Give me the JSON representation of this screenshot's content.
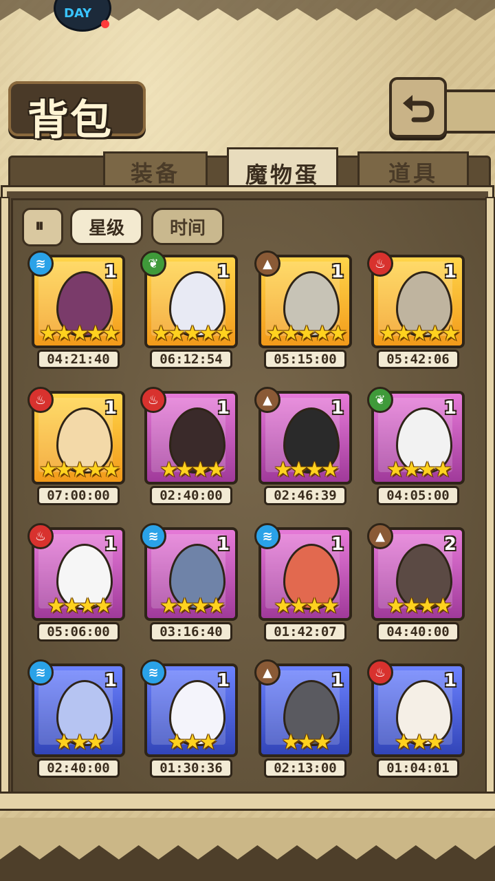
{
  "header": {
    "title": "背包",
    "back_icon": "back-arrow-icon",
    "app_badge": "DAY"
  },
  "tabs": [
    {
      "label": "装备",
      "active": false
    },
    {
      "label": "魔物蛋",
      "active": true
    },
    {
      "label": "道具",
      "active": false
    }
  ],
  "sort": {
    "toggle_icon": "sort-toggle-icon",
    "star_label": "星级",
    "time_label": "时间"
  },
  "eggs": [
    {
      "element": "water",
      "rarity": "gold",
      "count": "1",
      "stars": "★★★★★",
      "timer": "04:21:40",
      "color": "#7a3b6a"
    },
    {
      "element": "grass",
      "rarity": "gold",
      "count": "1",
      "stars": "★★★★★",
      "timer": "06:12:54",
      "color": "#e8eaf4"
    },
    {
      "element": "earth",
      "rarity": "gold",
      "count": "1",
      "stars": "★★★★★",
      "timer": "05:15:00",
      "color": "#c7c3b6"
    },
    {
      "element": "fire",
      "rarity": "gold",
      "count": "1",
      "stars": "★★★★★",
      "timer": "05:42:06",
      "color": "#bfb49f"
    },
    {
      "element": "fire",
      "rarity": "gold",
      "count": "1",
      "stars": "★★★★★",
      "timer": "07:00:00",
      "color": "#f3d9a8"
    },
    {
      "element": "fire",
      "rarity": "purple",
      "count": "1",
      "stars": "★★★★",
      "timer": "02:40:00",
      "color": "#3a2a2a"
    },
    {
      "element": "earth",
      "rarity": "purple",
      "count": "1",
      "stars": "★★★★",
      "timer": "02:46:39",
      "color": "#2a2a2a"
    },
    {
      "element": "grass",
      "rarity": "purple",
      "count": "1",
      "stars": "★★★★",
      "timer": "04:05:00",
      "color": "#f2f2f2"
    },
    {
      "element": "fire",
      "rarity": "purple",
      "count": "1",
      "stars": "★★★★",
      "timer": "05:06:00",
      "color": "#f6f6f6"
    },
    {
      "element": "water",
      "rarity": "purple",
      "count": "1",
      "stars": "★★★★",
      "timer": "03:16:40",
      "color": "#6f83a8"
    },
    {
      "element": "water",
      "rarity": "purple",
      "count": "1",
      "stars": "★★★★",
      "timer": "01:42:07",
      "color": "#e2694f"
    },
    {
      "element": "earth",
      "rarity": "purple",
      "count": "2",
      "stars": "★★★★",
      "timer": "04:40:00",
      "color": "#5b4a44"
    },
    {
      "element": "water",
      "rarity": "blue",
      "count": "1",
      "stars": "★★★",
      "timer": "02:40:00",
      "color": "#b6c4f2"
    },
    {
      "element": "water",
      "rarity": "blue",
      "count": "1",
      "stars": "★★★",
      "timer": "01:30:36",
      "color": "#f4f4fb"
    },
    {
      "element": "earth",
      "rarity": "blue",
      "count": "1",
      "stars": "★★★",
      "timer": "02:13:00",
      "color": "#5a5a60"
    },
    {
      "element": "fire",
      "rarity": "blue",
      "count": "1",
      "stars": "★★★",
      "timer": "01:04:01",
      "color": "#f5efe6"
    }
  ],
  "element_icons": {
    "water": "water-element-icon",
    "grass": "grass-element-icon",
    "earth": "earth-element-icon",
    "fire": "fire-element-icon"
  }
}
